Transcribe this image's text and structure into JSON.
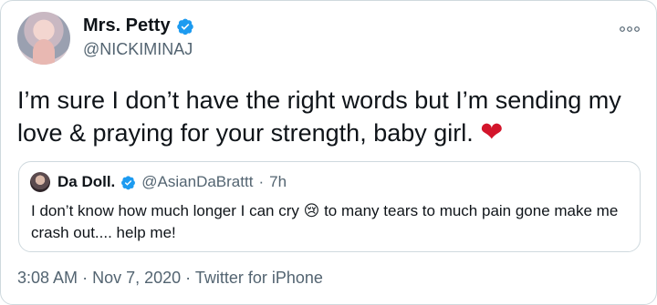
{
  "author": {
    "display_name": "Mrs. Petty",
    "handle": "@NICKIMINAJ"
  },
  "menu_icon": "more-options-icon",
  "tweet": {
    "text": "I’m sure I don’t have the right words but I’m sending my love & praying for your strength, baby girl.",
    "emoji": "❤"
  },
  "quoted": {
    "display_name": "Da Doll.",
    "handle": "@AsianDaBrattt",
    "separator": "·",
    "time": "7h",
    "text_before": "I don’t know how much longer I can cry",
    "emoji": "😢",
    "text_after": "to many tears to much pain gone make me crash out.... help me!"
  },
  "footer": {
    "time": "3:08 AM",
    "date": "Nov 7, 2020",
    "source": "Twitter for iPhone",
    "separator": "·"
  },
  "colors": {
    "text": "#0f1419",
    "secondary": "#536471",
    "border": "#cfd9de",
    "verified": "#1d9bf0",
    "heart": "#d3152b"
  }
}
